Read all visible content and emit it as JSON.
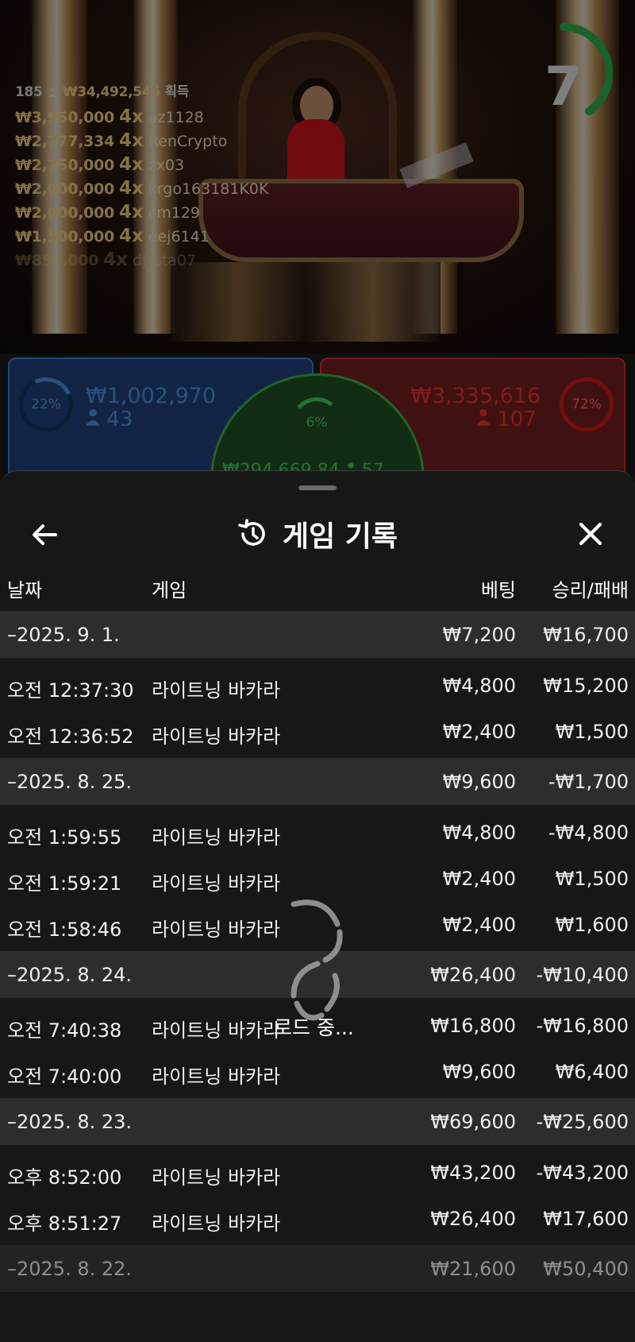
{
  "stream": {
    "summary": {
      "players": "185",
      "amount": "₩34,492,545",
      "suffix": "획득"
    },
    "winners": [
      {
        "amount": "₩3,950,000",
        "mult": "4x",
        "name": "az1128"
      },
      {
        "amount": "₩2,777,334",
        "mult": "4x",
        "name": "RenCrypto"
      },
      {
        "amount": "₩2,750,000",
        "mult": "4x",
        "name": "zx03"
      },
      {
        "amount": "₩2,000,000",
        "mult": "4x",
        "name": "krgo163181K0K"
      },
      {
        "amount": "₩2,000,000",
        "mult": "4x",
        "name": "cm129"
      },
      {
        "amount": "₩1,500,000",
        "mult": "4x",
        "name": "eej6141"
      },
      {
        "amount": "₩850,000",
        "mult": "4x",
        "name": "dj_sta07"
      }
    ],
    "timer": "7"
  },
  "bets": {
    "player": {
      "percent": "22%",
      "amount": "₩1,002,970",
      "count": "43",
      "color": "#4f8ad8"
    },
    "tie": {
      "percent": "6%",
      "amount": "₩294,669.84",
      "count": "57",
      "color": "#48c058"
    },
    "banker": {
      "percent": "72%",
      "amount": "₩3,335,616",
      "count": "107",
      "color": "#e03030"
    }
  },
  "sheet": {
    "title": "게임 기록",
    "columns": {
      "date": "날짜",
      "game": "게임",
      "bet": "베팅",
      "win": "승리/패배"
    },
    "groups": [
      {
        "date": "–2025. 9. 1.",
        "bet": "₩7,200",
        "win": "₩16,700",
        "entries": [
          {
            "time": "오전 12:37:30",
            "game": "라이트닝 바카라",
            "bet": "₩4,800",
            "win": "₩15,200"
          },
          {
            "time": "오전 12:36:52",
            "game": "라이트닝 바카라",
            "bet": "₩2,400",
            "win": "₩1,500"
          }
        ]
      },
      {
        "date": "–2025. 8. 25.",
        "bet": "₩9,600",
        "win": "-₩1,700",
        "entries": [
          {
            "time": "오전 1:59:55",
            "game": "라이트닝 바카라",
            "bet": "₩4,800",
            "win": "-₩4,800"
          },
          {
            "time": "오전 1:59:21",
            "game": "라이트닝 바카라",
            "bet": "₩2,400",
            "win": "₩1,500"
          },
          {
            "time": "오전 1:58:46",
            "game": "라이트닝 바카라",
            "bet": "₩2,400",
            "win": "₩1,600"
          }
        ]
      },
      {
        "date": "–2025. 8. 24.",
        "bet": "₩26,400",
        "win": "-₩10,400",
        "entries": [
          {
            "time": "오전 7:40:38",
            "game": "라이트닝 바카라",
            "bet": "₩16,800",
            "win": "-₩16,800"
          },
          {
            "time": "오전 7:40:00",
            "game": "라이트닝 바카라",
            "bet": "₩9,600",
            "win": "₩6,400"
          }
        ]
      },
      {
        "date": "–2025. 8. 23.",
        "bet": "₩69,600",
        "win": "-₩25,600",
        "entries": [
          {
            "time": "오후 8:52:00",
            "game": "라이트닝 바카라",
            "bet": "₩43,200",
            "win": "-₩43,200"
          },
          {
            "time": "오후 8:51:27",
            "game": "라이트닝 바카라",
            "bet": "₩26,400",
            "win": "₩17,600"
          }
        ]
      },
      {
        "date": "–2025. 8. 22.",
        "bet": "₩21,600",
        "win": "₩50,400",
        "entries": []
      }
    ],
    "loading_text": "로드 중..."
  }
}
